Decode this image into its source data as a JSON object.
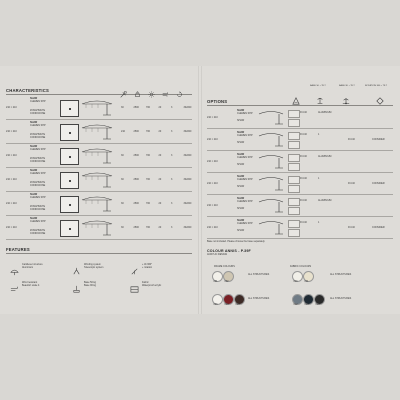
{
  "left": {
    "section_title": "CHARACTERISTICS",
    "rows": [
      {
        "size": "210 × 210",
        "model_a": "SHAW",
        "model_b": "CLEMEN SHP",
        "code_a": "ZONAHMUTE",
        "code_b": "CONDICIONE",
        "v1": "30",
        "v2": "2500",
        "v3": "700",
        "v4": "20",
        "v5": "3",
        "v6": "30x840"
      },
      {
        "size": "210 × 210",
        "model_a": "SHAW",
        "model_b": "CLEMEN SHP",
        "code_a": "ZONAHMUTE",
        "code_b": "CONDICIONE",
        "v1": "210",
        "v2": "2500",
        "v3": "700",
        "v4": "20",
        "v5": "3",
        "v6": "30x840"
      },
      {
        "size": "210 × 210",
        "model_a": "SHAW",
        "model_b": "CLEMEN SHP",
        "code_a": "ZONAHMUTE",
        "code_b": "CONDICIONE",
        "v1": "30",
        "v2": "2500",
        "v3": "700",
        "v4": "20",
        "v5": "3",
        "v6": "30x840"
      },
      {
        "size": "210 × 210",
        "model_a": "SHAW",
        "model_b": "CLEMEN SHP",
        "code_a": "ZONAHMUTE",
        "code_b": "CONDICIONE",
        "v1": "30",
        "v2": "2500",
        "v3": "700",
        "v4": "20",
        "v5": "3",
        "v6": "30x840"
      },
      {
        "size": "210 × 210",
        "model_a": "SHAW",
        "model_b": "CLEMEN SHP",
        "code_a": "ZONAHMUTE",
        "code_b": "CONDICIONE",
        "v1": "30",
        "v2": "2500",
        "v3": "700",
        "v4": "20",
        "v5": "3",
        "v6": "30x840"
      },
      {
        "size": "210 × 210",
        "model_a": "SHAW",
        "model_b": "CLEMEN SHP",
        "code_a": "ZONAHMUTE",
        "code_b": "CONDICIONE",
        "v1": "30",
        "v2": "2500",
        "v3": "700",
        "v4": "20",
        "v5": "3",
        "v6": "30x840"
      }
    ],
    "features_title": "FEATURES",
    "features": [
      {
        "icon": "umbrella-icon",
        "line1": "Cantilever structure",
        "line2": "Aluminium"
      },
      {
        "icon": "hand-crank-icon",
        "line1": "Winding system",
        "line2": "Telescopic system"
      },
      {
        "icon": "tilt-icon",
        "line1": "+ tilt 360°",
        "line2": "+ rotation"
      },
      {
        "icon": "wind-icon",
        "line1": "Wind resistant",
        "line2": "Beaufort scale 4"
      },
      {
        "icon": "base-icon",
        "line1": "Base 50 kg",
        "line2": "Base 90 kg"
      },
      {
        "icon": "fabric-icon",
        "line1": "Fabric",
        "line2": "Waterproof acrylic"
      }
    ]
  },
  "right": {
    "section_title": "OPTIONS",
    "column_heads": [
      "BASE 50 + TILT",
      "BASE 90 + TILT",
      "ROTATION 360 + TILT"
    ],
    "rows": [
      {
        "size": "210 × 210",
        "model_a": "SHAW",
        "model_b": "CLEMEN SHP",
        "opt1": "R.C40",
        "opt2": "ALUMINIUM",
        "opt3": "",
        "opt4": ""
      },
      {
        "size": "210 × 210",
        "model_a": "SHAW",
        "model_b": "CLEMEN SHP",
        "opt1": "R.C40",
        "opt2": "1",
        "opt3": "R.C40",
        "opt4": "CONSIDER"
      },
      {
        "size": "210 × 210",
        "model_a": "SHAW",
        "model_b": "CLEMEN SHP",
        "opt1": "R.C40",
        "opt2": "ALUMINIUM",
        "opt3": "",
        "opt4": ""
      },
      {
        "size": "210 × 210",
        "model_a": "SHAW",
        "model_b": "CLEMEN SHP",
        "opt1": "R.C40",
        "opt2": "1",
        "opt3": "R.C40",
        "opt4": "CONSIDER"
      },
      {
        "size": "210 × 210",
        "model_a": "SHAW",
        "model_b": "CLEMEN SHP",
        "opt1": "R.C40",
        "opt2": "ALUMINIUM",
        "opt3": "",
        "opt4": ""
      },
      {
        "size": "210 × 210",
        "model_a": "SHAW",
        "model_b": "CLEMEN SHP",
        "opt1": "R.C40",
        "opt2": "1",
        "opt3": "R.C40",
        "opt4": "CONSIDER"
      }
    ],
    "note": "Base not included. Please choose the base separately.",
    "colour_title": "COLOUR ANNIS - p.39F",
    "colour_sub": "ACRYLIC DESIGN",
    "frame_label": "FRAME COLOURS",
    "fabric_label": "FABRIC COLOURS",
    "frame_swatches": [
      {
        "color": "#f2f0ea",
        "code": "001"
      },
      {
        "color": "#cfc6b2",
        "code": "002"
      }
    ],
    "fabric_swatches_top": [
      {
        "color": "#f1efe8",
        "code": "010"
      },
      {
        "color": "#e8e1cd",
        "code": "011"
      }
    ],
    "frame_swatches_2": [
      {
        "color": "#f3f1ec",
        "code": "003"
      },
      {
        "color": "#7a1f24",
        "code": "004"
      },
      {
        "color": "#3d2a25",
        "code": "005"
      }
    ],
    "fabric_swatches_2": [
      {
        "color": "#6f7b85",
        "code": "012"
      },
      {
        "color": "#1f2a33",
        "code": "013"
      },
      {
        "color": "#2a2a2a",
        "code": "014"
      }
    ],
    "all_label": "ALL STRUCTURES"
  }
}
